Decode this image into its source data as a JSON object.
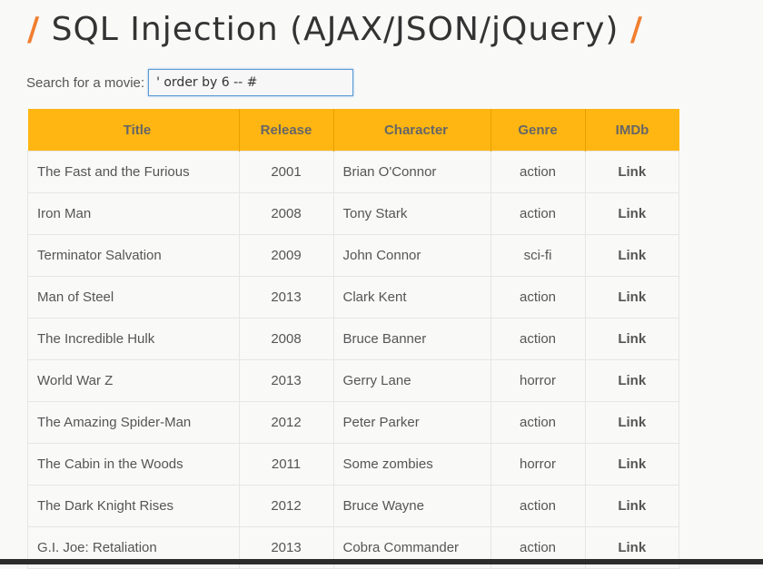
{
  "header": {
    "title": "SQL Injection (AJAX/JSON/jQuery)",
    "slash": "/"
  },
  "search": {
    "label": "Search for a movie:",
    "value": "' order by 6 -- #"
  },
  "table": {
    "columns": [
      "Title",
      "Release",
      "Character",
      "Genre",
      "IMDb"
    ],
    "rows": [
      {
        "title": "The Fast and the Furious",
        "release": "2001",
        "character": "Brian O'Connor",
        "genre": "action",
        "imdb": "Link"
      },
      {
        "title": "Iron Man",
        "release": "2008",
        "character": "Tony Stark",
        "genre": "action",
        "imdb": "Link"
      },
      {
        "title": "Terminator Salvation",
        "release": "2009",
        "character": "John Connor",
        "genre": "sci-fi",
        "imdb": "Link"
      },
      {
        "title": "Man of Steel",
        "release": "2013",
        "character": "Clark Kent",
        "genre": "action",
        "imdb": "Link"
      },
      {
        "title": "The Incredible Hulk",
        "release": "2008",
        "character": "Bruce Banner",
        "genre": "action",
        "imdb": "Link"
      },
      {
        "title": "World War Z",
        "release": "2013",
        "character": "Gerry Lane",
        "genre": "horror",
        "imdb": "Link"
      },
      {
        "title": "The Amazing Spider-Man",
        "release": "2012",
        "character": "Peter Parker",
        "genre": "action",
        "imdb": "Link"
      },
      {
        "title": "The Cabin in the Woods",
        "release": "2011",
        "character": "Some zombies",
        "genre": "horror",
        "imdb": "Link"
      },
      {
        "title": "The Dark Knight Rises",
        "release": "2012",
        "character": "Bruce Wayne",
        "genre": "action",
        "imdb": "Link"
      },
      {
        "title": "G.I. Joe: Retaliation",
        "release": "2013",
        "character": "Cobra Commander",
        "genre": "action",
        "imdb": "Link"
      }
    ]
  },
  "colors": {
    "accent": "#f07f2f",
    "header_bg": "#ffb612"
  }
}
